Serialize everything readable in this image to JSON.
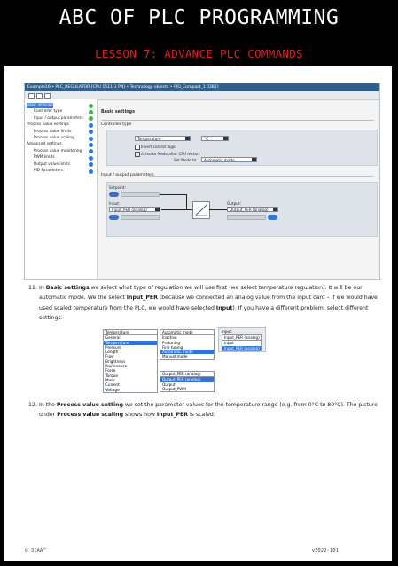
{
  "header": {
    "title": "ABC OF PLC PROGRAMMING",
    "subtitle": "LESSON 7: ADVANCE PLC COMMANDS"
  },
  "screenshot": {
    "breadcrumb": "Example16 • PLC_REGULATOR [CPU 1511-1 PN] • Technology objects • PID_Compact_1 [DB2]",
    "nav": [
      {
        "label": "Basic settings",
        "status": "green",
        "selected": true
      },
      {
        "label": "Controller type",
        "status": "green"
      },
      {
        "label": "Input / output parameters",
        "status": "green"
      },
      {
        "label": "Process value settings",
        "status": "blue"
      },
      {
        "label": "Process value limits",
        "status": "blue"
      },
      {
        "label": "Process value scaling",
        "status": "blue"
      },
      {
        "label": "Advanced settings",
        "status": "blue"
      },
      {
        "label": "Process value monitoring",
        "status": "blue"
      },
      {
        "label": "PWM limits",
        "status": "blue"
      },
      {
        "label": "Output value limits",
        "status": "blue"
      },
      {
        "label": "PID Parameters",
        "status": "blue"
      }
    ],
    "basic_settings": "Basic settings",
    "controller_type": "Controller type",
    "type_value": "Temperature",
    "unit_value": "°C",
    "invert": "Invert control logic",
    "activate": "Activate Mode after CPU restart",
    "set_mode_label": "Set Mode to:",
    "set_mode_value": "Automatic mode",
    "io_params": "Input / output parameters",
    "setpoint": "Setpoint:",
    "input": "Input:",
    "input_value": "Input_PER (analog)",
    "output": "Output:",
    "output_value": "Output_PER (analog)"
  },
  "para11": {
    "num": "11.",
    "t1": "In ",
    "b1": "Basic settings",
    "t2": " we select what type of regulation we will use first (we select temperature regulation). It will be our automatic mode. We the select ",
    "b2": "Input_PER",
    "t3": " (because we connected an analog value from the input card – if we would have used scaled temperature from the PLC, we would have selected ",
    "b3": "Input",
    "t4": "). If you have a different problem, select different settings."
  },
  "mid": {
    "type_header": "Temperature",
    "type_list": [
      "General",
      "Temperature",
      "Pressure",
      "Length",
      "Flow",
      "Brightness",
      "Illuminance",
      "Force",
      "Torque",
      "Mass",
      "Current",
      "Voltage"
    ],
    "mode_header": "Automatic mode",
    "mode_list": [
      "Inactive",
      "Pretuning",
      "Fine tuning",
      "Automatic mode",
      "Manual mode"
    ],
    "in_label": "Input:",
    "in_header": "Input_PER (analog)",
    "in_list": [
      "Input",
      "Input_PER (analog)"
    ],
    "out_header": "Output_PER (analog)",
    "out_list": [
      "Output_PER (analog)",
      "Output",
      "Output_PWM"
    ]
  },
  "para12": {
    "num": "12.",
    "t1": "In the ",
    "b1": "Process value setting",
    "t2": " we set the parameter values for the temperature range (e.g. from 0°C to 80°C). The picture under ",
    "b2": "Process value scaling",
    "t3": " shows how ",
    "b3": "Input_PER",
    "t4": " is scaled."
  },
  "footer": {
    "left": "© 3IAA™",
    "right": "v2022-101"
  }
}
